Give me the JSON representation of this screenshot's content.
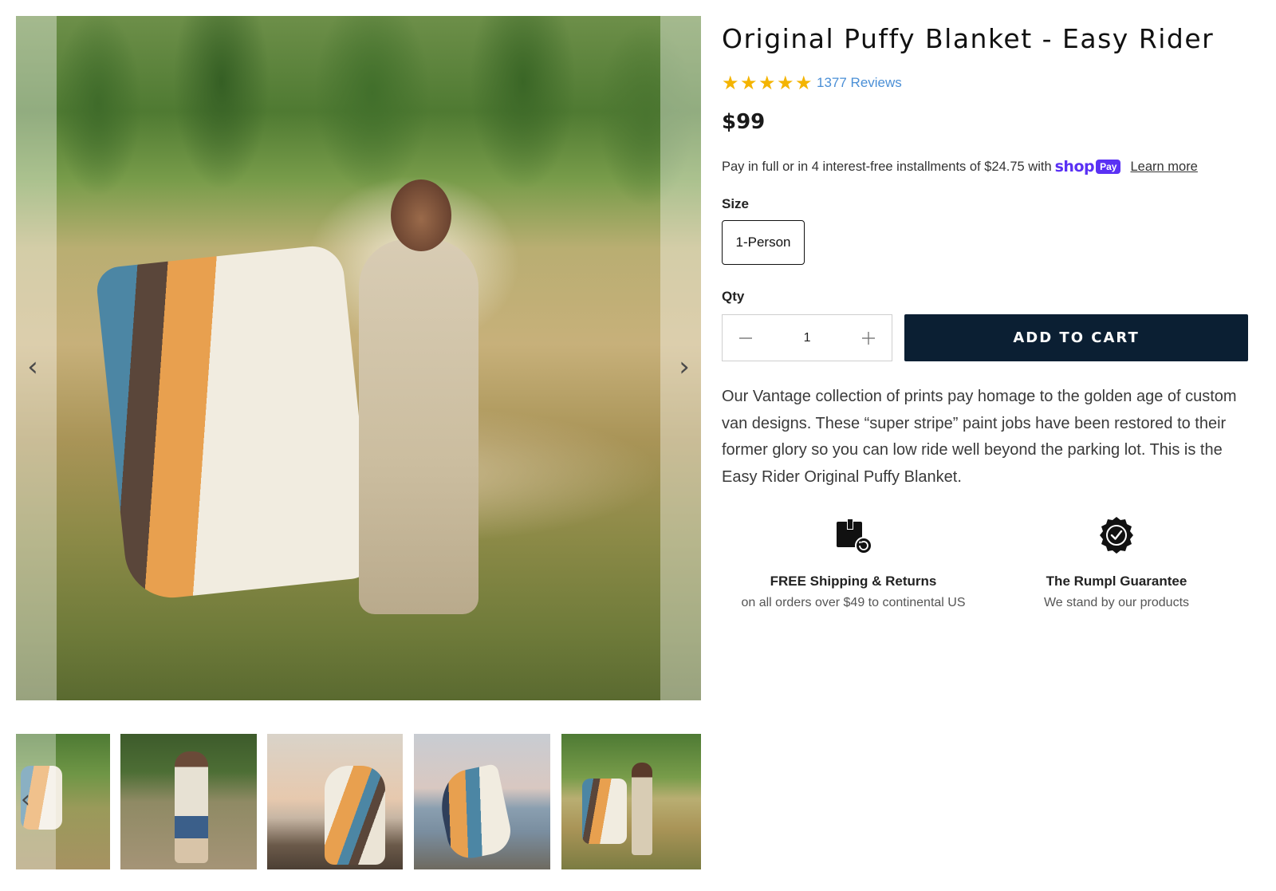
{
  "gallery": {
    "main_image_alt": "",
    "prev_icon": "chevron-left-icon",
    "next_icon": "chevron-right-icon",
    "prev_glyph": "‹",
    "next_glyph": "›",
    "thumbnails_count": 5
  },
  "product": {
    "title": "Original Puffy Blanket - Easy Rider",
    "star_glyph": "★",
    "rating_stars": 5,
    "reviews": "1377 Reviews",
    "price": "$99",
    "installments_text": "Pay in full or in 4 interest-free installments of $24.75 with",
    "shop_pay_word": "shop",
    "shop_pay_badge": "Pay",
    "learn_more": "Learn more",
    "size_label": "Size",
    "size_selected": "1-Person",
    "qty_label": "Qty",
    "qty_value": "1",
    "add_to_cart": "ADD TO CART",
    "description": "Our Vantage collection of prints pay homage to the golden age of custom van designs. These “super stripe” paint jobs have been restored to their former glory so you can low ride well beyond the parking lot. This is the Easy Rider Original Puffy Blanket."
  },
  "features": [
    {
      "icon": "box-return-icon",
      "title": "FREE Shipping & Returns",
      "subtitle": "on all orders over $49 to continental US"
    },
    {
      "icon": "badge-check-icon",
      "title": "The Rumpl Guarantee",
      "subtitle": "We stand by our products"
    }
  ],
  "colors": {
    "star": "#f4b400",
    "reviews_link": "#4a8fd6",
    "shop_pay": "#5a31f4",
    "add_to_cart_bg": "#0b1f33"
  }
}
